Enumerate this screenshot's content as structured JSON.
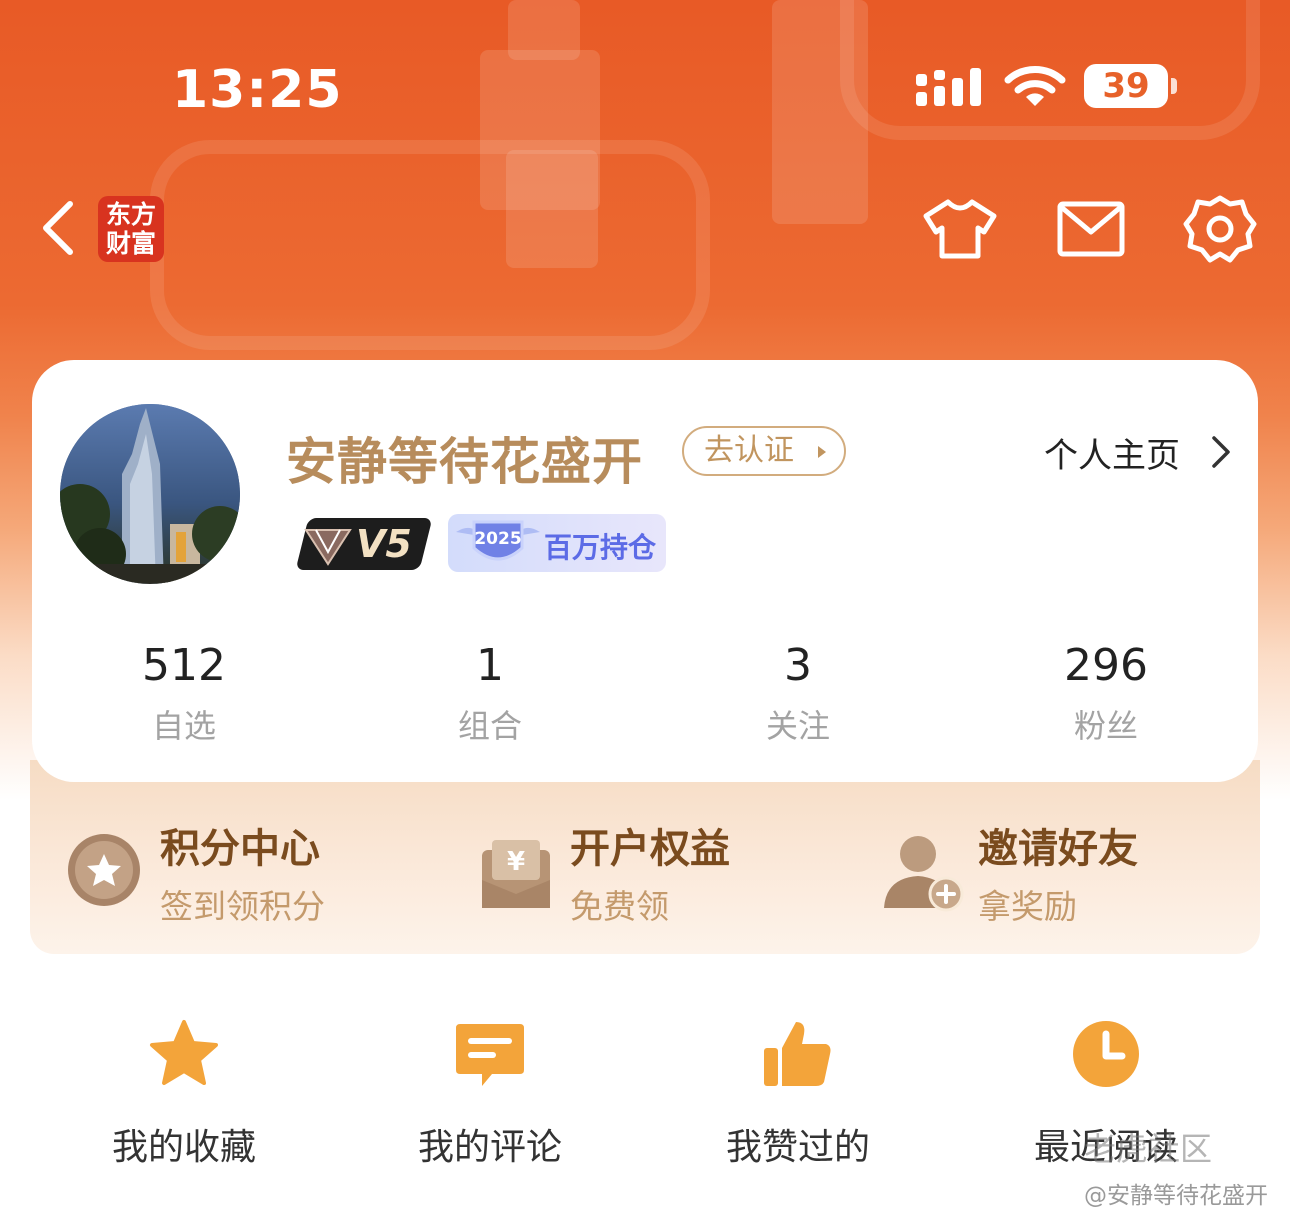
{
  "status_bar": {
    "time": "13:25",
    "battery": "39"
  },
  "topnav": {
    "logo_line1": "东方",
    "logo_line2": "财富"
  },
  "profile": {
    "username": "安静等待花盛开",
    "verify_label": "去认证",
    "homepage_label": "个人主页",
    "level_badge": "V5",
    "badge_year": "2025",
    "badge_label": "百万持仓"
  },
  "stats": [
    {
      "value": "512",
      "label": "自选"
    },
    {
      "value": "1",
      "label": "组合"
    },
    {
      "value": "3",
      "label": "关注"
    },
    {
      "value": "296",
      "label": "粉丝"
    }
  ],
  "perks": [
    {
      "title": "积分中心",
      "subtitle": "签到领积分"
    },
    {
      "title": "开户权益",
      "subtitle": "免费领"
    },
    {
      "title": "邀请好友",
      "subtitle": "拿奖励"
    }
  ],
  "quick_links": [
    {
      "label": "我的收藏",
      "icon": "star-icon"
    },
    {
      "label": "我的评论",
      "icon": "comment-icon"
    },
    {
      "label": "我赞过的",
      "icon": "thumbs-up-icon"
    },
    {
      "label": "最近阅读",
      "icon": "clock-icon"
    }
  ],
  "watermark": {
    "line1": "老虎社区",
    "line2": "@安静等待花盛开"
  },
  "colors": {
    "brand_orange": "#e85a26",
    "gold_text": "#b78c5c",
    "perk_title": "#7a4b1e",
    "quick_icon": "#f3a43a"
  }
}
